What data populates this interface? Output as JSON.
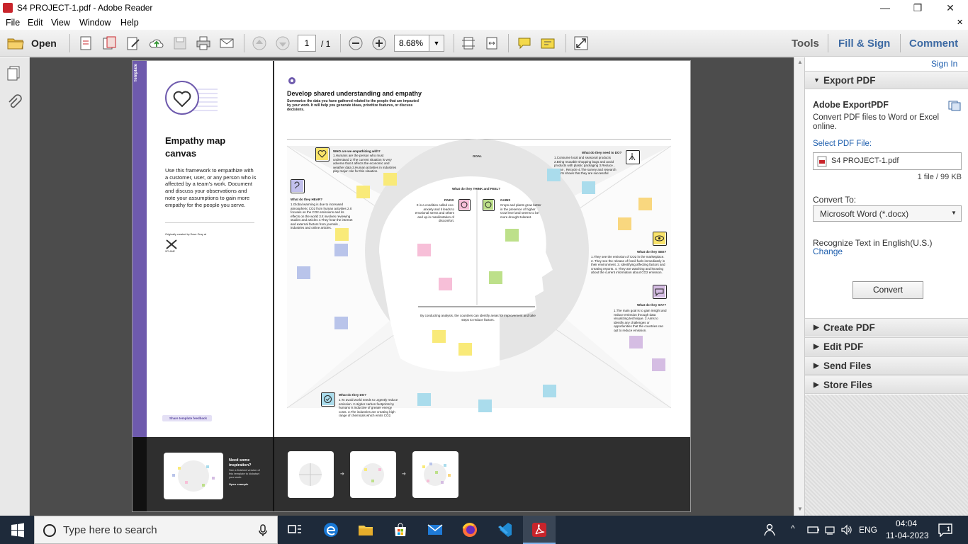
{
  "window": {
    "title": "S4 PROJECT-1.pdf - Adobe Reader",
    "minimize": "—",
    "restore": "❐",
    "close": "✕"
  },
  "menu": {
    "items": [
      "File",
      "Edit",
      "View",
      "Window",
      "Help"
    ],
    "close_doc": "✕"
  },
  "toolbar": {
    "open_label": "Open",
    "page_current": "1",
    "page_total": "/ 1",
    "zoom": "8.68%",
    "tools_label": "Tools",
    "fill_sign_label": "Fill & Sign",
    "comment_label": "Comment"
  },
  "document": {
    "tag": "Template",
    "canvas_title": "Empathy map canvas",
    "canvas_desc": "Use this framework to empathize with a customer, user, or any person who is affected by a team's work. Document and discuss your observations and note your assumptions to gain more empathy for the people you serve.",
    "origin": "Originally created by Dave Gray at",
    "org": "XPLANE",
    "feedback": "Share template feedback",
    "heading": "Develop shared understanding and empathy",
    "subheading": "Summarize the data you have gathered related to the people that are impacted by your work. It will help you generate ideas, prioritize features, or discuss decisions.",
    "who_title": "WHO are we empathizing with?",
    "who_text": "1.Humans are the person who must understand 2.The current situation is very adverse that it affects the economic and weather data 3.Human activities in industries play major role for this situation.",
    "goal": "GOAL",
    "do_need_title": "What do they need to DO?",
    "do_need_text": "1.Consume local and seasonal products 2.Bring reusable shopping bags and avoid products with plastic packaging 3.Reduce , Reuse , Recycle 4.The survey and research reports shows that they are successful",
    "hear_title": "What do they HEAR?",
    "hear_text": "1.Global warming is due to increased atmospheric CO2 from human activities 2.It focuses on the CO2 emissions and its effects on the world 3.It involves reviewing studies and articles 4.They hear the internet and external factors from journals , industries and online articles.",
    "think_title": "What do they THINK and FEEL?",
    "pains_title": "PAINS",
    "pains_text": "It is a condition called eco-anxiety and it leads to emotional stress and others and up-in manifestation of discomfort.",
    "gains_title": "GAINS",
    "gains_text": "Crops and plants grow better in the presence of higher CO2 level and seems to be more drought tolerant.",
    "see_title": "What do they SEE?",
    "see_text": "1.They see the emission of CO2 in the marketplace. 2. They see the release of fossil fuels immediately in their environment. 3. Identifying affecting factors and creating reports. 4. They are watching and knowing about the current information about CO2 emission.",
    "say_title": "What do they SAY?",
    "say_text": "1.The main goal is to gain insight and reduce emission through data visualizing technique. 2.Aims to identify any challenges or opportunities that the countries can opt to reduce emission.",
    "do_title": "What do they DO?",
    "do_text": "1.To avoid world needs to urgently reduce emission. 2.Higher carbon footprints by humans is inductive of greater energy costs. 3.The industries are creating high range of chemicals which emits CO2.",
    "bottom_text": "By conducting analysis, the countries can identify areas for improvement and take steps to reduce factors.",
    "inspiration_title": "Need some inspiration?",
    "inspiration_text": "See a finished version of this template to kickstart your work.",
    "open_example": "Open example"
  },
  "right_panel": {
    "sign_in": "Sign In",
    "export_header": "Export PDF",
    "service_title": "Adobe ExportPDF",
    "service_desc": "Convert PDF files to Word or Excel online.",
    "select_label": "Select PDF File:",
    "file_name": "S4 PROJECT-1.pdf",
    "file_info": "1 file / 99 KB",
    "convert_to_label": "Convert To:",
    "convert_to_value": "Microsoft Word (*.docx)",
    "recognize_text": "Recognize Text in English(U.S.)",
    "change_link": "Change",
    "convert_button": "Convert",
    "sections": [
      "Create PDF",
      "Edit PDF",
      "Send Files",
      "Store Files"
    ]
  },
  "taskbar": {
    "search_placeholder": "Type here to search",
    "language": "ENG",
    "time": "04:04",
    "date": "11-04-2023",
    "notification_count": "1"
  }
}
